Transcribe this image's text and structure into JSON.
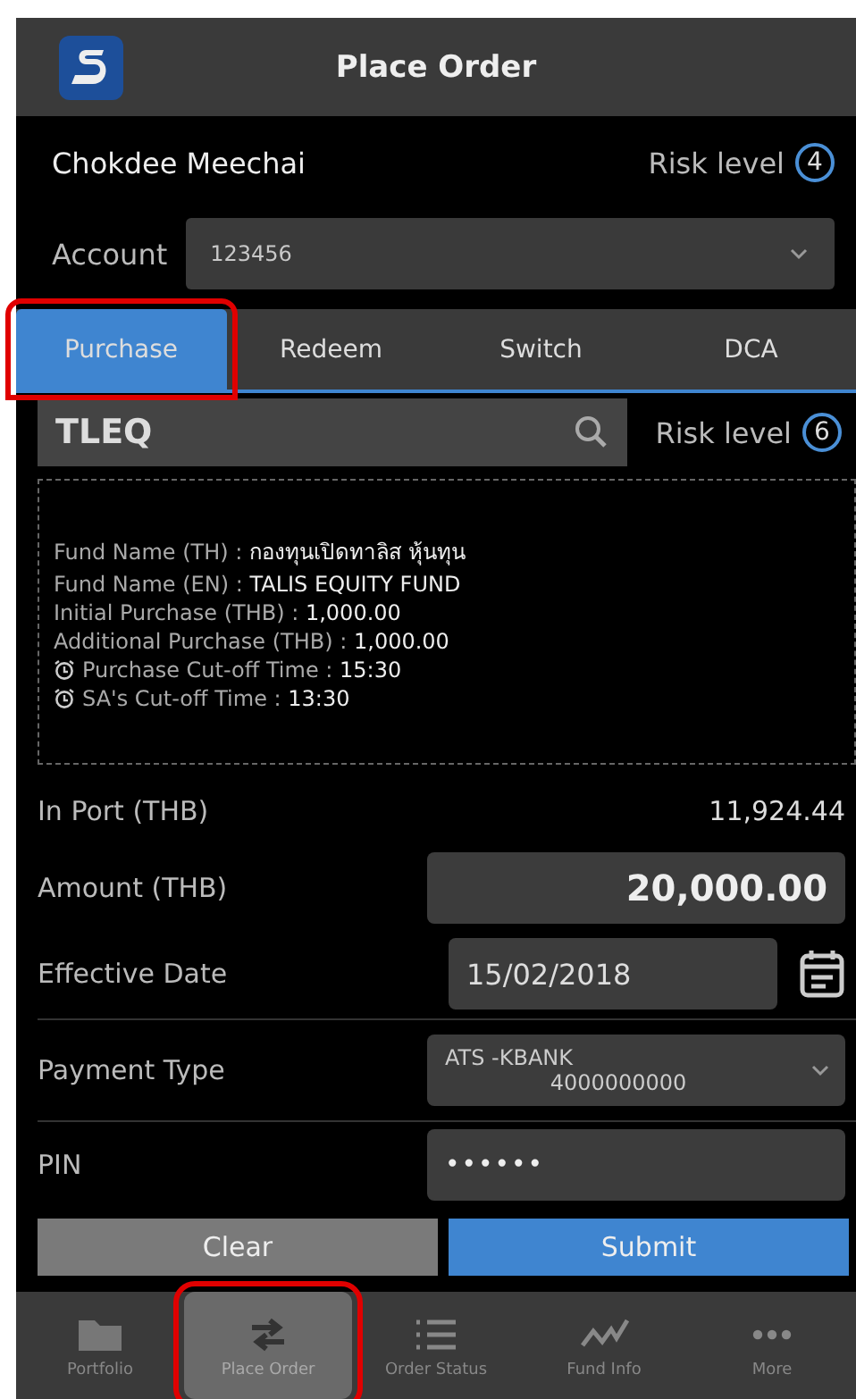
{
  "header": {
    "title": "Place Order"
  },
  "customer": {
    "name": "Chokdee Meechai",
    "risk_label": "Risk level",
    "risk_value": "4"
  },
  "account": {
    "label": "Account",
    "value": "123456"
  },
  "tabs": [
    {
      "label": "Purchase",
      "selected": true,
      "highlighted": true
    },
    {
      "label": "Redeem",
      "selected": false,
      "highlighted": false
    },
    {
      "label": "Switch",
      "selected": false,
      "highlighted": false
    },
    {
      "label": "DCA",
      "selected": false,
      "highlighted": false
    }
  ],
  "fund_search": {
    "value": "TLEQ",
    "risk_label": "Risk level",
    "risk_value": "6"
  },
  "fund_info": [
    {
      "label": "Fund Name (TH) :",
      "value": "กองทุนเปิดทาลิส หุ้นทุน",
      "kind": "text"
    },
    {
      "label": "Fund Name (EN) :",
      "value": "TALIS EQUITY FUND",
      "kind": "text"
    },
    {
      "label": "Initial Purchase (THB) :",
      "value": "1,000.00",
      "kind": "text"
    },
    {
      "label": "Additional Purchase (THB) :",
      "value": "1,000.00",
      "kind": "text"
    },
    {
      "label": "Purchase Cut-off Time :",
      "value": "15:30",
      "kind": "time"
    },
    {
      "label": "SA's Cut-off Time :",
      "value": "13:30",
      "kind": "time"
    }
  ],
  "in_port": {
    "label": "In Port (THB)",
    "value": "11,924.44"
  },
  "amount": {
    "label": "Amount (THB)",
    "value": "20,000.00"
  },
  "effective_date": {
    "label": "Effective Date",
    "value": "15/02/2018"
  },
  "payment_type": {
    "label": "Payment Type",
    "value": "ATS -KBANK",
    "account": "4000000000"
  },
  "pin": {
    "label": "PIN",
    "value": "••••••"
  },
  "buttons": [
    {
      "label": "Clear",
      "kind": "secondary"
    },
    {
      "label": "Submit",
      "kind": "primary"
    }
  ],
  "nav": [
    {
      "label": "Portfolio",
      "kind": "folder",
      "selected": false,
      "highlighted": false
    },
    {
      "label": "Place Order",
      "kind": "transfer",
      "selected": true,
      "highlighted": true
    },
    {
      "label": "Order Status",
      "kind": "list",
      "selected": false,
      "highlighted": false
    },
    {
      "label": "Fund Info",
      "kind": "chart",
      "selected": false,
      "highlighted": false
    },
    {
      "label": "More",
      "kind": "more",
      "selected": false,
      "highlighted": false
    }
  ]
}
